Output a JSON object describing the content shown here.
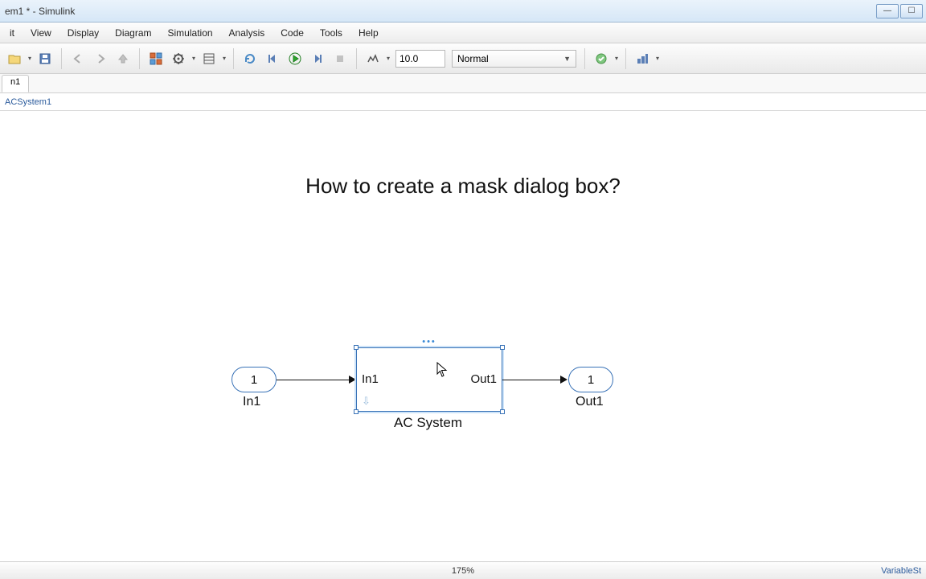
{
  "window": {
    "title": "em1 * - Simulink"
  },
  "menubar": [
    "it",
    "View",
    "Display",
    "Diagram",
    "Simulation",
    "Analysis",
    "Code",
    "Tools",
    "Help"
  ],
  "toolbar": {
    "stop_time": "10.0",
    "sim_mode": "Normal"
  },
  "tabs": [
    "n1"
  ],
  "breadcrumb": "ACSystem1",
  "annotation": "How to create a mask dialog box?",
  "diagram": {
    "in_port": {
      "value": "1",
      "label": "In1"
    },
    "out_port": {
      "value": "1",
      "label": "Out1"
    },
    "subsystem": {
      "in_label": "In1",
      "out_label": "Out1",
      "name": "AC System"
    }
  },
  "statusbar": {
    "zoom": "175%",
    "right": "VariableSt"
  }
}
